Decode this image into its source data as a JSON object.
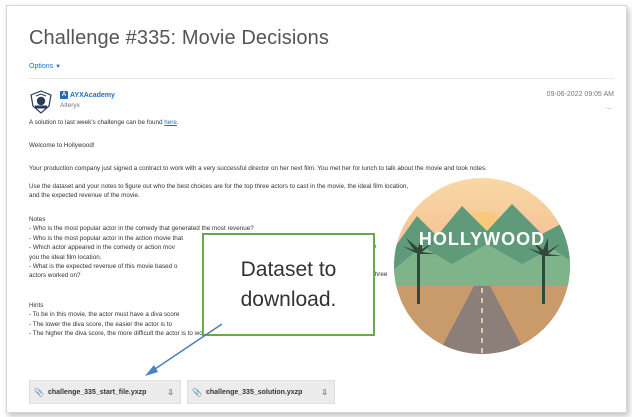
{
  "post": {
    "title": "Challenge #335: Movie Decisions",
    "options_label": "Options",
    "author_name": "AYXAcademy",
    "author_org": "Alteryx",
    "timestamp": "09-06-2022 09:05 AM",
    "kebab": "...",
    "solution_line_prefix": "A solution to last week's challenge can be found ",
    "solution_link": "here",
    "solution_line_suffix": ".",
    "welcome": "Welcome to Hollywood!",
    "intro": "Your production company just signed a contract to work with a very successful director on her next film. You met her for lunch to talk about the movie and took notes.",
    "task": "Use the dataset and your notes to figure out who the best choices are for the top three actors to cast in the movie, the ideal film location, and the expected revenue of the movie.",
    "notes_heading": "Notes",
    "notes": [
      "- Who is the most popular actor in the comedy that generated the most revenue?",
      "- Who is the most popular actor in the action movie that",
      "- Which actor appeared in the comedy or action mov",
      "you the ideal film location.",
      "- What is the expected revenue of this movie based o",
      "actors worked on?"
    ],
    "notes_right": [
      "e",
      "three"
    ],
    "hints_heading": "Hints",
    "hints": [
      "- To be in this movie, the actor must have a diva score",
      "- The lower the diva score, the easier the actor is to",
      "- The higher the diva score, the more difficult the actor is to work with."
    ]
  },
  "image": {
    "sign_text": "HOLLYWOOD"
  },
  "callout": {
    "line1": "Dataset to",
    "line2": "download."
  },
  "attachments": [
    {
      "name": "challenge_335_start_file.yxzp"
    },
    {
      "name": "challenge_335_solution.yxzp"
    }
  ],
  "colors": {
    "link": "#1a6fc4",
    "callout_border": "#6aa84f",
    "arrow": "#4a7fc1"
  }
}
